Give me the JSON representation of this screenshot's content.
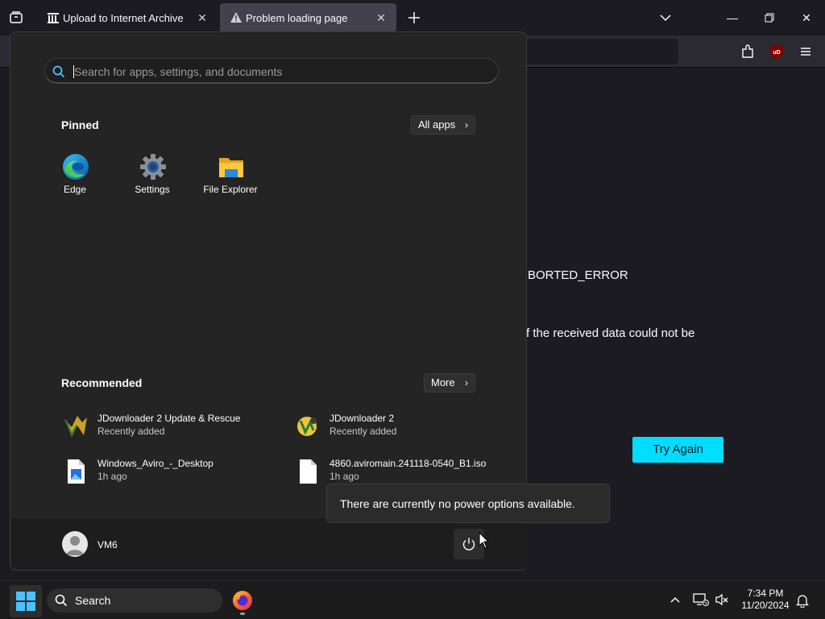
{
  "browser": {
    "tabs": [
      {
        "label": "Upload to Internet Archive",
        "icon": "archive-icon",
        "active": false
      },
      {
        "label": "Problem loading page",
        "icon": "warning-icon",
        "active": true
      }
    ],
    "error_code_fragment": "BORTED_ERROR",
    "error_desc_fragment": "f the received data could not be",
    "try_again_label": "Try Again",
    "accent_color": "#00ddff"
  },
  "start_menu": {
    "search_placeholder": "Search for apps, settings, and documents",
    "pinned_title": "Pinned",
    "all_apps_label": "All apps",
    "pinned_apps": [
      {
        "label": "Edge",
        "icon": "edge-icon"
      },
      {
        "label": "Settings",
        "icon": "settings-gear-icon"
      },
      {
        "label": "File Explorer",
        "icon": "folder-icon"
      }
    ],
    "recommended_title": "Recommended",
    "more_label": "More",
    "recommended": [
      {
        "title": "JDownloader 2 Update & Rescue",
        "subtitle": "Recently added",
        "icon": "jdownloader-icon"
      },
      {
        "title": "JDownloader 2",
        "subtitle": "Recently added",
        "icon": "jdownloader-icon"
      },
      {
        "title": "Windows_Aviro_-_Desktop",
        "subtitle": "1h ago",
        "icon": "image-file-icon"
      },
      {
        "title": "4860.aviromain.241118-0540_B1.iso",
        "subtitle": "1h ago",
        "icon": "file-icon"
      }
    ],
    "user_name": "VM6",
    "power_tooltip": "There are currently no power options available."
  },
  "taskbar": {
    "search_label": "Search",
    "time": "7:34 PM",
    "date": "11/20/2024"
  }
}
